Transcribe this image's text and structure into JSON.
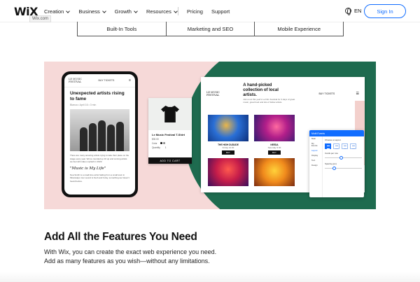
{
  "header": {
    "logo": "WiX",
    "logo_tooltip": "Wix.com",
    "nav": [
      {
        "label": "Creation"
      },
      {
        "label": "Business"
      },
      {
        "label": "Growth"
      },
      {
        "label": "Resources"
      }
    ],
    "links": [
      "Pricing",
      "Support"
    ],
    "language": "EN",
    "signin": "Sign In"
  },
  "tabs": [
    "Built-In Tools",
    "Marketing and SEO",
    "Mobile Experience"
  ],
  "colors": {
    "accent": "#116dff",
    "hero_bg": "#f6d9d8",
    "hero_green": "#1e6b4f"
  },
  "mockup": {
    "phone": {
      "logo": "LE MUSIC FESTIVAL",
      "buy": "BUY TICKETS",
      "title": "Unexpected artists rising to fame",
      "meta": "Bianca • April 16 • 3 min",
      "text1": "There are many amazing artists trying to take their place on the stage every year. We've rounded up 10 up and coming artists we feel will make a splash in 2020.",
      "quote": "\"Music is My Life\"",
      "text2": "Noa Smith is a small time artist hailing from a small town in Mississippi. Her sound is fresh and funky, something we haven't heard before."
    },
    "merch": {
      "name": "Le Music Festival T-Shirt",
      "price": "$30.00",
      "color_label": "Color",
      "quantity_label": "Quantity",
      "quantity": "1",
      "cta": "ADD TO CART"
    },
    "desktop": {
      "logo": "LE MUSIC FESTIVAL",
      "title": "A hand-picked collection of local artists.",
      "subtitle": "Join us at this year's Le Film Festival for 3 days of great music, great food and lots of fellow artists.",
      "buy": "BUY TICKETS",
      "cards": [
        {
          "caption": "THE HIGH DUDUDE",
          "date": "Friday 12:30",
          "button": "BUY"
        },
        {
          "caption": "NEEDA",
          "date": "Saturday 9:30",
          "button": "BUY"
        },
        {
          "caption": "",
          "date": "",
          "button": ""
        },
        {
          "caption": "",
          "date": "",
          "button": ""
        }
      ]
    },
    "panel": {
      "title": "Multi Events",
      "menu": [
        "Main",
        "My Events",
        "Layout",
        "Display",
        "Text",
        "Design"
      ],
      "section1": "Choose a Layout",
      "section2": "Cards per row",
      "section3": "Spacing (px)"
    }
  },
  "section": {
    "heading": "Add All the Features You Need",
    "line1": "With Wix, you can create the exact web experience you need.",
    "line2": "Add as many features as you wish—without any limitations."
  }
}
